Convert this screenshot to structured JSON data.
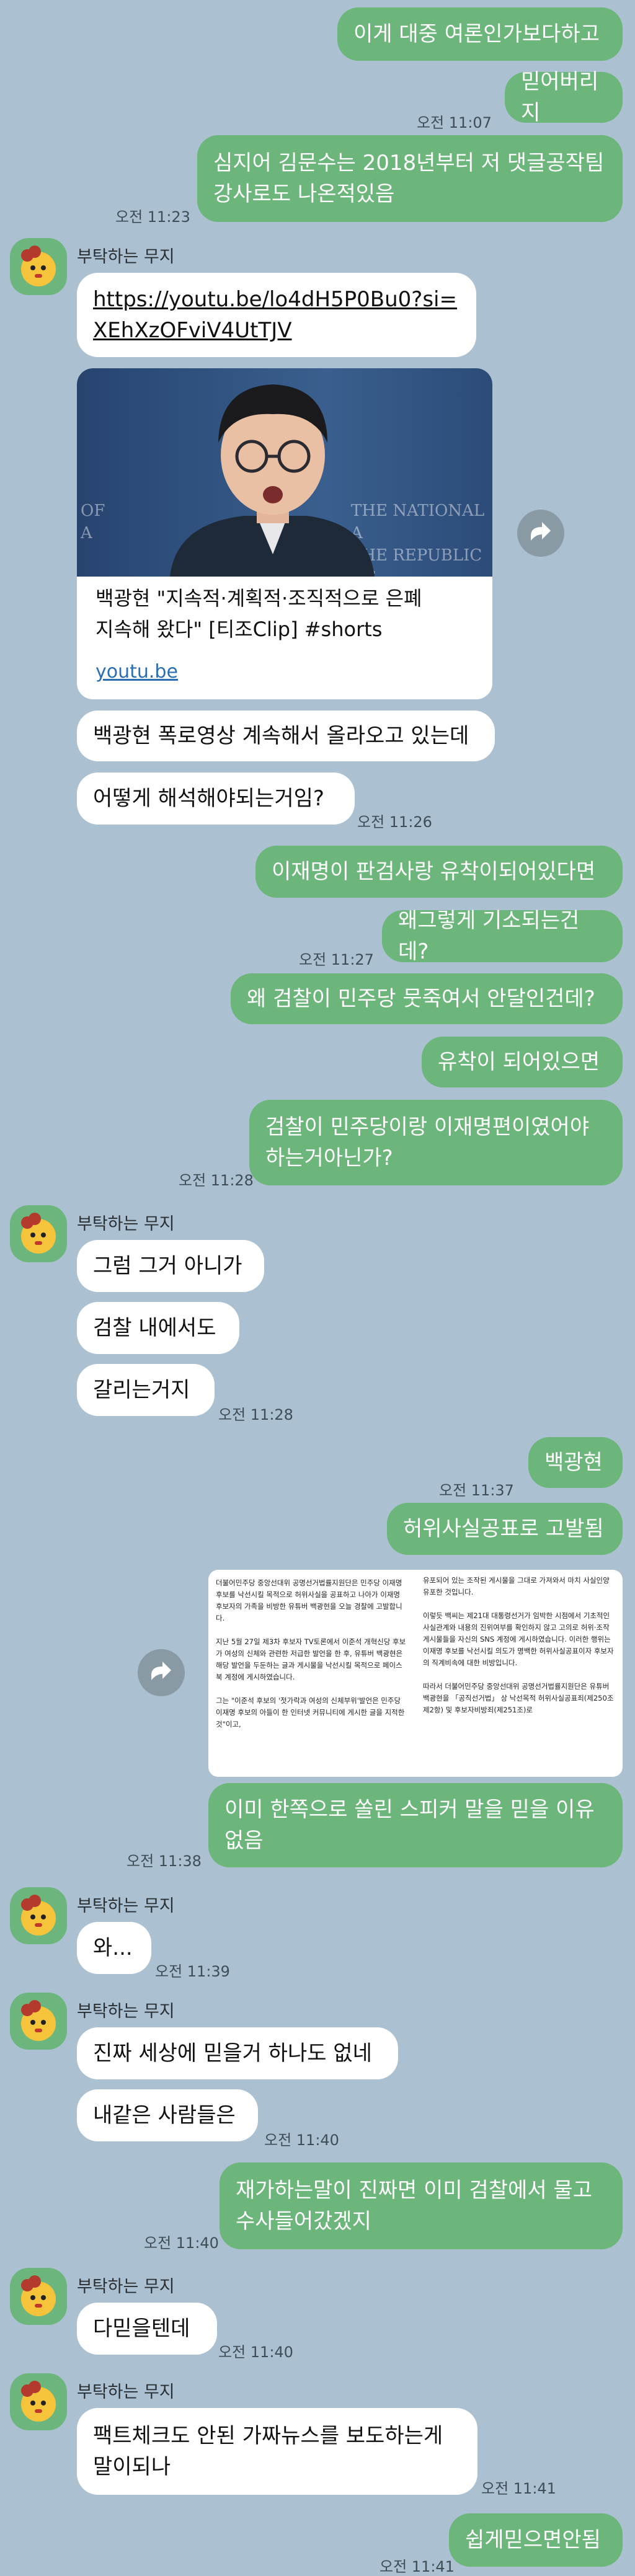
{
  "sender_name": "부탁하는 무지",
  "messages": {
    "m1": "이게 대중 여론인가보다하고",
    "m2": "믿어버리지",
    "t1": "오전 11:07",
    "m3": "심지어 김문수는 2018년부터 저 댓글공작팀\n강사로도 나온적있음",
    "t2": "오전 11:23",
    "link_msg": "https://youtu.be/lo4dH5P0Bu0?si=\nXEhXzOFviV4UtTJV",
    "card_title": "백광현 \"지속적·계획적·조직적으로 은폐\n지속해 왔다\" [티조Clip] #shorts",
    "card_domain": "youtu.be",
    "card_bg_text": "THE NATIONAL A\nTHE REPUBLIC OF",
    "card_bg_left": "OF\nA",
    "o1": "백광현 폭로영상 계속해서 올라오고 있는데",
    "o2": "어떻게 해석해야되는거임?",
    "t3": "오전 11:26",
    "m4": "이재명이 판검사랑 유착이되어있다면",
    "m5": "왜그렇게 기소되는건데?",
    "t4": "오전 11:27",
    "m6": "왜 검찰이 민주당 뭇죽여서 안달인건데?",
    "m7": "유착이 되어있으면",
    "m8": "검찰이 민주당이랑 이재명편이였어야\n하는거아닌가?",
    "t5": "오전 11:28",
    "o3": "그럼 그거 아니가",
    "o4": "검찰 내에서도",
    "o5": "갈리는거지",
    "t6": "오전 11:28",
    "m9": "백광현",
    "t7": "오전 11:37",
    "m10": "허위사실공표로 고발됨",
    "doc_left": "더불어민주당 중앙선대위 공명선거법률지원단은 민주당 이재명 후보를 낙선시킬 목적으로 허위사실을 공표하고 나아가 이재명 후보자의 가족을 비방한 유튜버 백광현을 오늘 경찰에 고발합니다.\n\n지난 5월 27일 제3차 후보자 TV토론에서 이준석 개혁신당 후보가 여성의 신체와 관련한 저급한 발언을 한 후, 유튜버 백광현은 해당 발언을 두둔하는 글과 게시물을 낙선시킬 목적으로 페이스북 계정에 게시하였습니다.\n\n그는 \"이준석 후보의 '젓가락과 여성의 신체부위'발언은 민주당 이재명 후보의 아들이 한 인터넷 커뮤니티에 게시한 글을 지적한 것\"이고,",
    "doc_right": "유포되어 있는 조작된 게시물을 그대로 가져와서 마치 사실인양 유포한 것입니다.\n\n이렇듯 백씨는 제21대 대통령선거가 임박한 시점에서 기초적인 사실관계와 내용의 진위여부를 확인하지 않고 고의로 허위·조작 게시물들을 자신의 SNS 계정에 게시하였습니다. 이러한 행위는 이재명 후보를 낙선시킬 의도가 명백한 허위사실공표이자 후보자의 직계비속에 대한 비방입니다.\n\n따라서 더불어민주당 중앙선대위 공명선거법률지원단은 유튜버 백광현을 「공직선거법」 상 낙선목적 허위사실공표죄(제250조 제2항) 및 후보자비방죄(제251조)로",
    "m11": "이미 한쪽으로 쏠린 스피커 말을 믿을 이유\n없음",
    "t8": "오전 11:38",
    "o6": "와...",
    "t9": "오전 11:39",
    "o7": "진짜 세상에 믿을거 하나도 없네",
    "o8": "내같은 사람들은",
    "t10": "오전 11:40",
    "m12": "재가하는말이 진짜면 이미 검찰에서 물고\n수사들어갔겠지",
    "t11": "오전 11:40",
    "o9": "다믿을텐데",
    "t12": "오전 11:40",
    "o10": "팩트체크도 안된 가짜뉴스를 보도하는게\n말이되나",
    "t13": "오전 11:41",
    "m13": "쉽게믿으면안됨",
    "t14": "오전 11:41"
  },
  "colors": {
    "background": "#abc1d1",
    "my_bubble": "#6cb57b",
    "their_bubble": "#ffffff"
  }
}
